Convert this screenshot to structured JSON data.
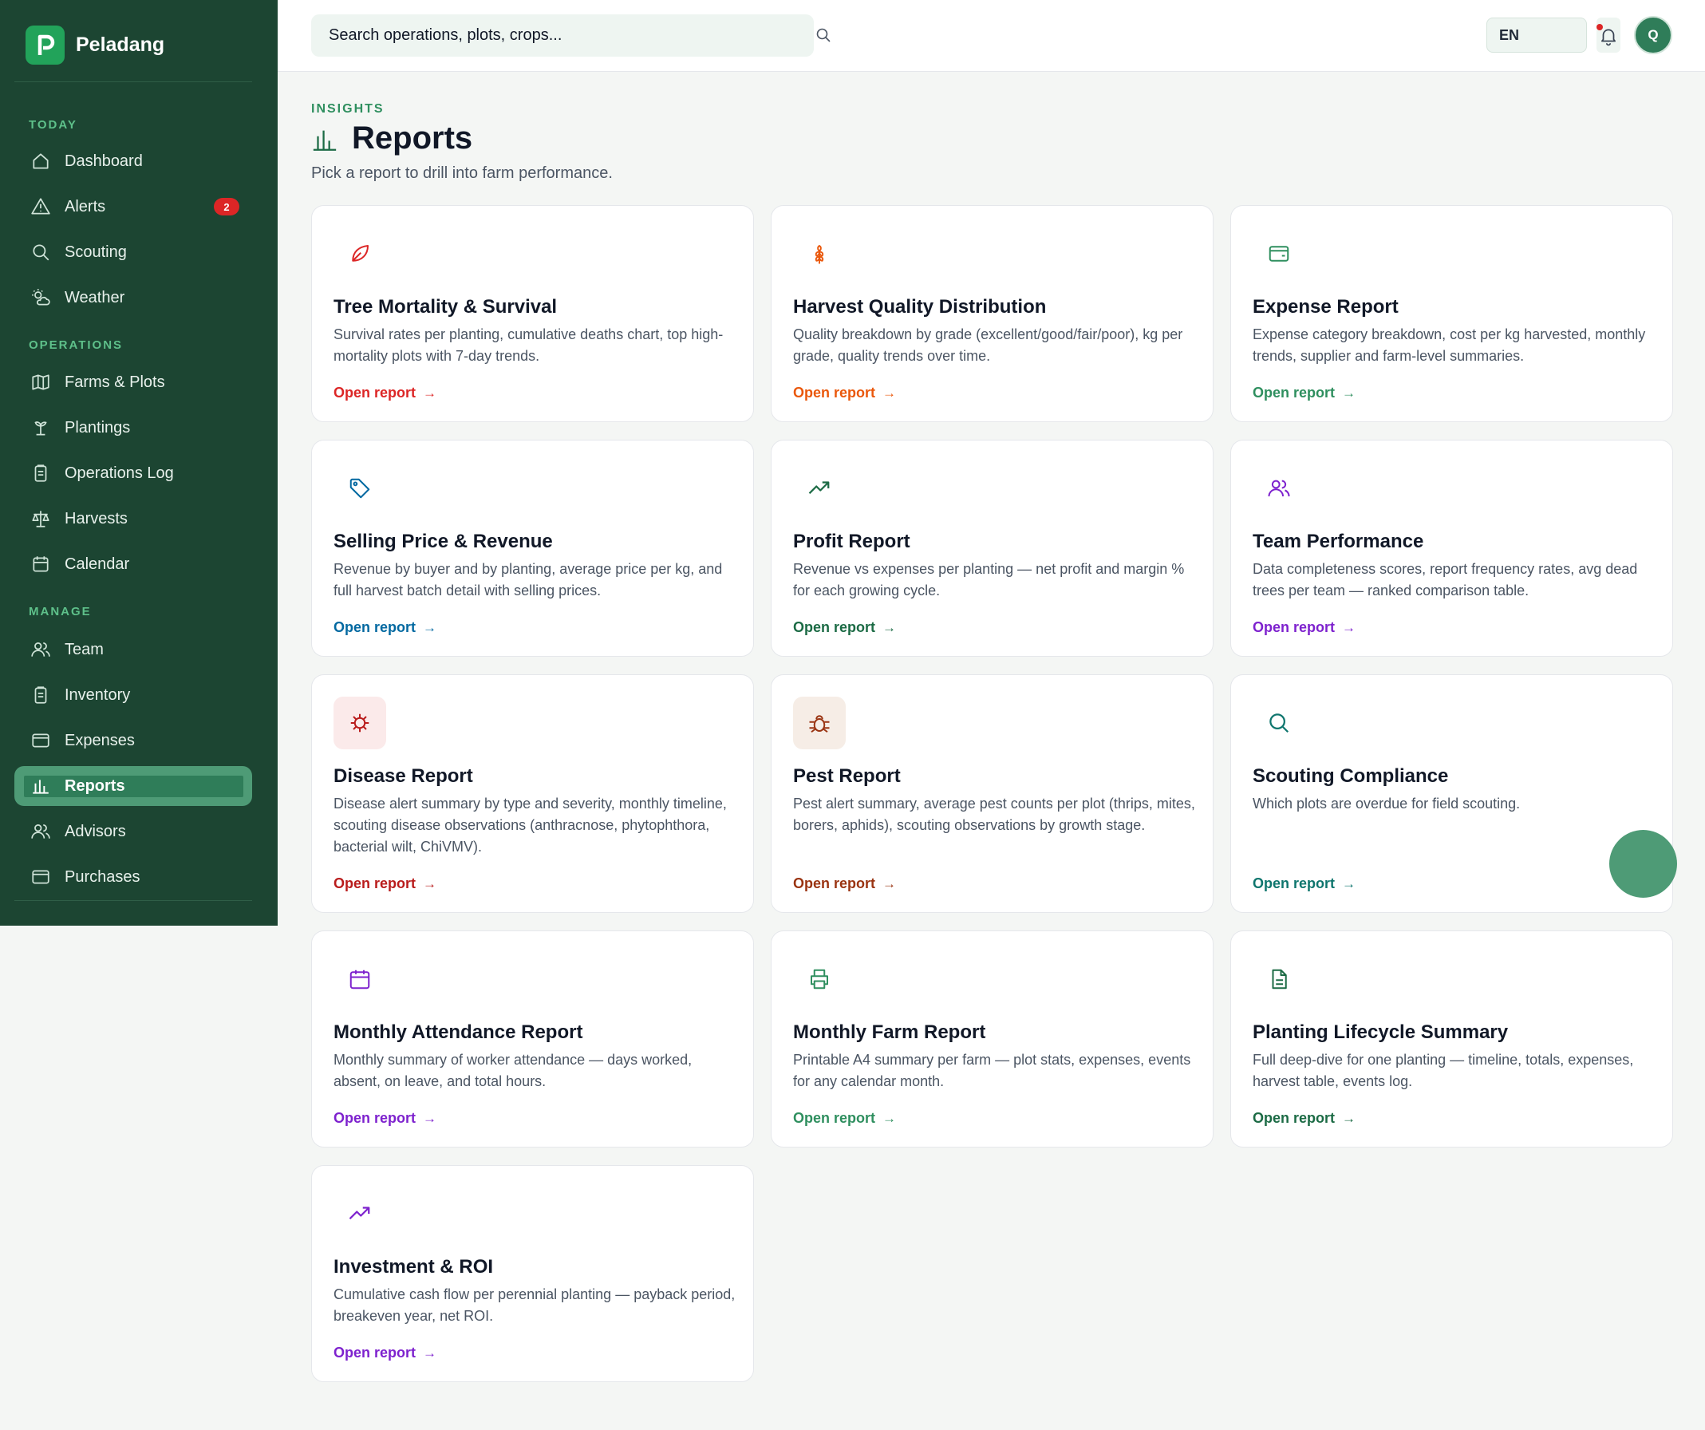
{
  "app": {
    "name": "Peladang"
  },
  "sidebar": {
    "sections": [
      "TODAY",
      "OPERATIONS",
      "MANAGE"
    ],
    "items": [
      {
        "label": "Dashboard",
        "icon": "home-icon"
      },
      {
        "label": "Alerts",
        "icon": "warning-icon",
        "badge": "2"
      },
      {
        "label": "Scouting",
        "icon": "search-icon"
      },
      {
        "label": "Weather",
        "icon": "weather-icon"
      },
      {
        "label": "Farms & Plots",
        "icon": "map-icon"
      },
      {
        "label": "Plantings",
        "icon": "sprout-icon"
      },
      {
        "label": "Operations Log",
        "icon": "clipboard-icon"
      },
      {
        "label": "Harvests",
        "icon": "scale-icon"
      },
      {
        "label": "Calendar",
        "icon": "calendar-icon"
      },
      {
        "label": "Team",
        "icon": "users-icon"
      },
      {
        "label": "Inventory",
        "icon": "clipboard-icon"
      },
      {
        "label": "Expenses",
        "icon": "wallet-icon"
      },
      {
        "label": "Reports",
        "icon": "bar-chart-icon",
        "active": true
      },
      {
        "label": "Advisors",
        "icon": "users-icon"
      },
      {
        "label": "Purchases",
        "icon": "wallet-icon"
      }
    ]
  },
  "topbar": {
    "search_placeholder": "Search operations, plots, crops...",
    "language": "EN",
    "avatar_initial": "Q"
  },
  "page": {
    "eyebrow": "INSIGHTS",
    "title": "Reports",
    "subtitle": "Pick a report to drill into farm performance."
  },
  "cards": [
    {
      "title": "Tree Mortality & Survival",
      "desc": "Survival rates per planting, cumulative deaths chart, top high-mortality plots with 7-day trends.",
      "link": "Open report",
      "arrow": "→",
      "icon": "leaf-icon",
      "color": "#dc2626"
    },
    {
      "title": "Harvest Quality Distribution",
      "desc": "Quality breakdown by grade (excellent/good/fair/poor), kg per grade, quality trends over time.",
      "link": "Open report",
      "arrow": "→",
      "icon": "wheat-icon",
      "color": "#ea580c"
    },
    {
      "title": "Expense Report",
      "desc": "Expense category breakdown, cost per kg harvested, monthly trends, supplier and farm-level summaries.",
      "link": "Open report",
      "arrow": "→",
      "icon": "wallet-icon",
      "color": "#2f8f5f"
    },
    {
      "title": "Selling Price & Revenue",
      "desc": "Revenue by buyer and by planting, average price per kg, and full harvest batch detail with selling prices.",
      "link": "Open report",
      "arrow": "→",
      "icon": "tag-icon",
      "color": "#0369a1"
    },
    {
      "title": "Profit Report",
      "desc": "Revenue vs expenses per planting — net profit and margin % for each growing cycle.",
      "link": "Open report",
      "arrow": "→",
      "icon": "trending-up-icon",
      "color": "#1c6b45"
    },
    {
      "title": "Team Performance",
      "desc": "Data completeness scores, report frequency rates, avg dead trees per team — ranked comparison table.",
      "link": "Open report",
      "arrow": "→",
      "icon": "users-icon",
      "color": "#7e22ce"
    },
    {
      "title": "Disease Report",
      "desc": "Disease alert summary by type and severity, monthly timeline, scouting disease observations (anthracnose, phytophthora, bacterial wilt, ChiVMV).",
      "link": "Open report",
      "arrow": "→",
      "icon": "virus-icon",
      "color": "#b91c1c"
    },
    {
      "title": "Pest Report",
      "desc": "Pest alert summary, average pest counts per plot (thrips, mites, borers, aphids), scouting observations by growth stage.",
      "link": "Open report",
      "arrow": "→",
      "icon": "bug-icon",
      "color": "#9a3412"
    },
    {
      "title": "Scouting Compliance",
      "desc": "Which plots are overdue for field scouting.",
      "link": "Open report",
      "arrow": "→",
      "icon": "search-icon",
      "color": "#0f766e"
    },
    {
      "title": "Monthly Attendance Report",
      "desc": "Monthly summary of worker attendance — days worked, absent, on leave, and total hours.",
      "link": "Open report",
      "arrow": "→",
      "icon": "calendar-icon",
      "color": "#7e22ce"
    },
    {
      "title": "Monthly Farm Report",
      "desc": "Printable A4 summary per farm — plot stats, expenses, events for any calendar month.",
      "link": "Open report",
      "arrow": "→",
      "icon": "printer-icon",
      "color": "#2f8f5f"
    },
    {
      "title": "Planting Lifecycle Summary",
      "desc": "Full deep-dive for one planting — timeline, totals, expenses, harvest table, events log.",
      "link": "Open report",
      "arrow": "→",
      "icon": "document-icon",
      "color": "#1c6b45"
    },
    {
      "title": "Investment & ROI",
      "desc": "Cumulative cash flow per perennial planting — payback period, breakeven year, net ROI.",
      "link": "Open report",
      "arrow": "→",
      "icon": "trending-up-icon",
      "color": "#7e22ce"
    }
  ]
}
